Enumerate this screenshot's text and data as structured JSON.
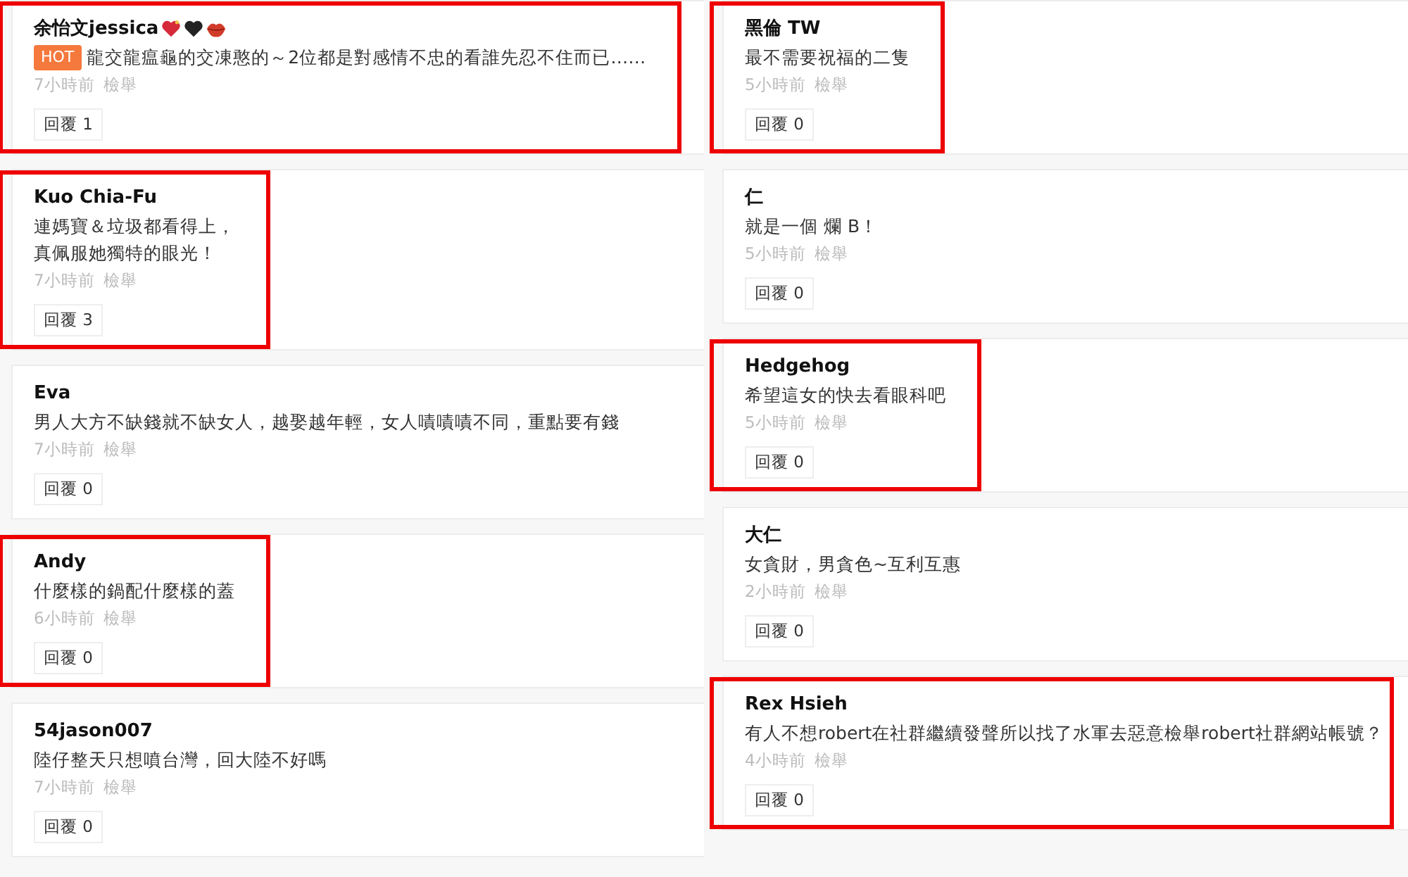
{
  "columns": [
    {
      "comments": [
        {
          "name": "余怡文jessica",
          "name_icons": [
            {
              "kind": "sparkle-heart"
            },
            {
              "kind": "black-heart"
            },
            {
              "kind": "lips"
            }
          ],
          "tag": "HOT",
          "lines": [
            "龍交龍瘟龜的交凍憨的～2位都是對感情不忠的看誰先忍不住而已……"
          ],
          "time": "7小時前",
          "report": "檢舉",
          "reply": "回覆 1",
          "highlighted": true
        },
        {
          "name": "Kuo Chia-Fu",
          "lines": [
            "連媽寶＆垃圾都看得上，",
            "真佩服她獨特的眼光！"
          ],
          "time": "7小時前",
          "report": "檢舉",
          "reply": "回覆 3",
          "highlighted": true
        },
        {
          "name": "Eva",
          "lines": [
            "男人大方不缺錢就不缺女人，越娶越年輕，女人嘖嘖嘖不同，重點要有錢"
          ],
          "time": "7小時前",
          "report": "檢舉",
          "reply": "回覆 0",
          "highlighted": false
        },
        {
          "name": "Andy",
          "lines": [
            "什麼樣的鍋配什麼樣的蓋"
          ],
          "time": "6小時前",
          "report": "檢舉",
          "reply": "回覆 0",
          "highlighted": true
        },
        {
          "name": "54jason007",
          "lines": [
            "陸仔整天只想噴台灣，回大陸不好嗎"
          ],
          "time": "7小時前",
          "report": "檢舉",
          "reply": "回覆 0",
          "highlighted": false
        }
      ]
    },
    {
      "comments": [
        {
          "name": "黑倫 TW",
          "lines": [
            "最不需要祝福的二隻"
          ],
          "time": "5小時前",
          "report": "檢舉",
          "reply": "回覆 0",
          "highlighted": true
        },
        {
          "name": "仁",
          "lines": [
            "就是一個 爛 B！"
          ],
          "time": "5小時前",
          "report": "檢舉",
          "reply": "回覆 0",
          "highlighted": false
        },
        {
          "name": "Hedgehog",
          "lines": [
            "希望這女的快去看眼科吧"
          ],
          "time": "5小時前",
          "report": "檢舉",
          "reply": "回覆 0",
          "highlighted": true
        },
        {
          "name": "大仁",
          "lines": [
            "女貪財，男貪色~互利互惠"
          ],
          "time": "2小時前",
          "report": "檢舉",
          "reply": "回覆 0",
          "highlighted": false
        },
        {
          "name": "Rex Hsieh",
          "lines": [
            "有人不想robert在社群繼續發聲所以找了水軍去惡意檢舉robert社群網站帳號？"
          ],
          "time": "4小時前",
          "report": "檢舉",
          "reply": "回覆 0",
          "highlighted": true
        }
      ]
    }
  ]
}
